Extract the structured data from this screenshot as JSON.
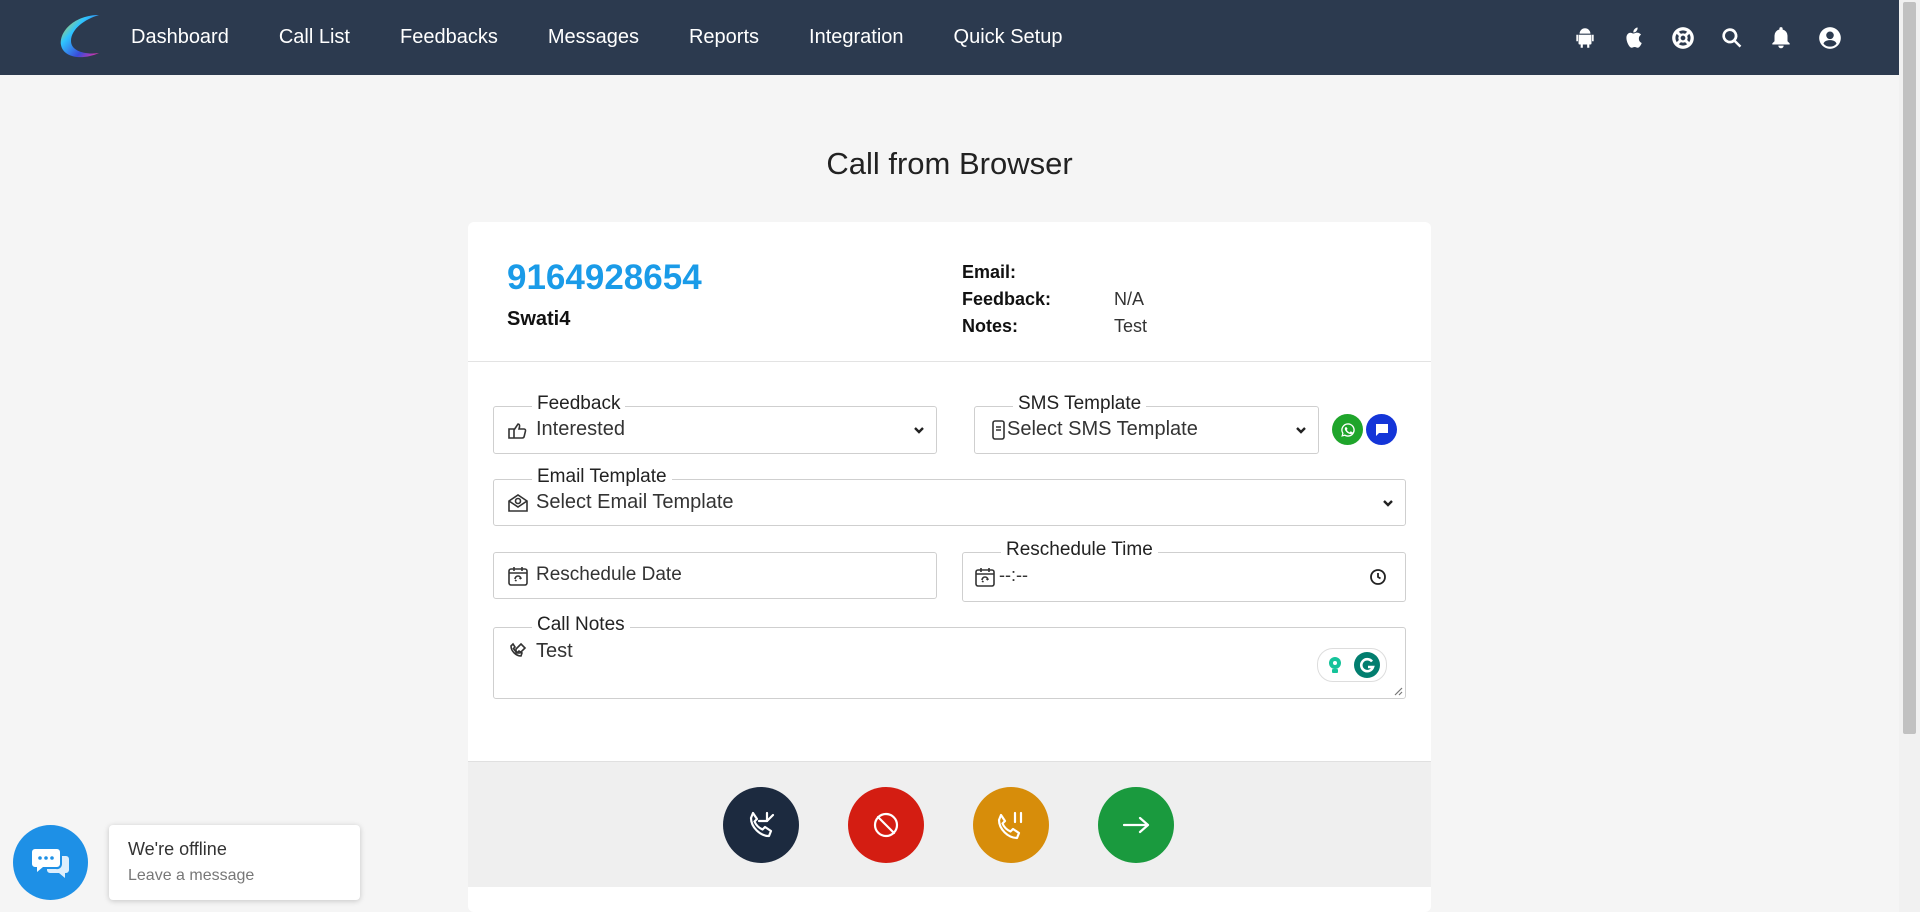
{
  "nav": {
    "menu": [
      "Dashboard",
      "Call List",
      "Feedbacks",
      "Messages",
      "Reports",
      "Integration",
      "Quick Setup"
    ],
    "icons": [
      "android-icon",
      "apple-icon",
      "support-icon",
      "search-icon",
      "bell-icon",
      "user-icon"
    ]
  },
  "page": {
    "title": "Call from Browser"
  },
  "contact": {
    "phone": "9164928654",
    "name": "Swati4",
    "email_label": "Email:",
    "email_value": "",
    "feedback_label": "Feedback:",
    "feedback_value": "N/A",
    "notes_label": "Notes:",
    "notes_value": "Test"
  },
  "form": {
    "feedback_label": "Feedback",
    "feedback_value": "Interested",
    "sms_label": "SMS Template",
    "sms_value": "Select SMS Template",
    "email_label": "Email Template",
    "email_value": "Select Email Template",
    "resched_date_placeholder": "Reschedule Date",
    "resched_time_label": "Reschedule Time",
    "resched_time_value": "--:--",
    "notes_label": "Call Notes",
    "notes_value": "Test"
  },
  "colors": {
    "nav_bg": "#2c3a4f",
    "phone_blue": "#1a9be8",
    "whatsapp": "#1fa52b",
    "sms": "#1435d8",
    "receive": "#1c2a3f",
    "reject": "#d41d12",
    "hold": "#d78d0a",
    "next": "#1a9a3e",
    "chat": "#1e90e6"
  },
  "chat": {
    "title": "We're offline",
    "subtitle": "Leave a message"
  }
}
